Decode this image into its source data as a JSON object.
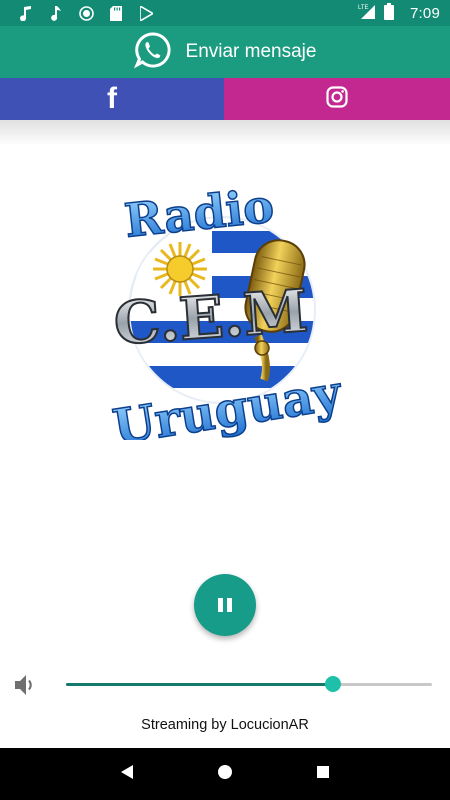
{
  "status_bar": {
    "time": "7:09",
    "network": "LTE",
    "left_icons": [
      "music-note-icon",
      "music-note-icon",
      "sync-icon",
      "sd-card-icon",
      "play-store-icon"
    ]
  },
  "whatsapp": {
    "label": "Enviar mensaje",
    "icon": "whatsapp-icon",
    "color": "#1b9b80"
  },
  "social": {
    "facebook_glyph": "f",
    "facebook_color": "#3f51b5",
    "instagram_color": "#c2288f"
  },
  "logo": {
    "line1": "Radio",
    "line2": "C.E.M",
    "line3": "Uruguay"
  },
  "player": {
    "state": "playing",
    "button_icon": "pause-icon",
    "accent": "#179c8a"
  },
  "volume": {
    "level": 0.73,
    "icon": "volume-icon"
  },
  "footer": {
    "credit": "Streaming by LocucionAR"
  },
  "nav": {
    "back": "back-icon",
    "home": "home-icon",
    "recents": "recents-icon"
  }
}
